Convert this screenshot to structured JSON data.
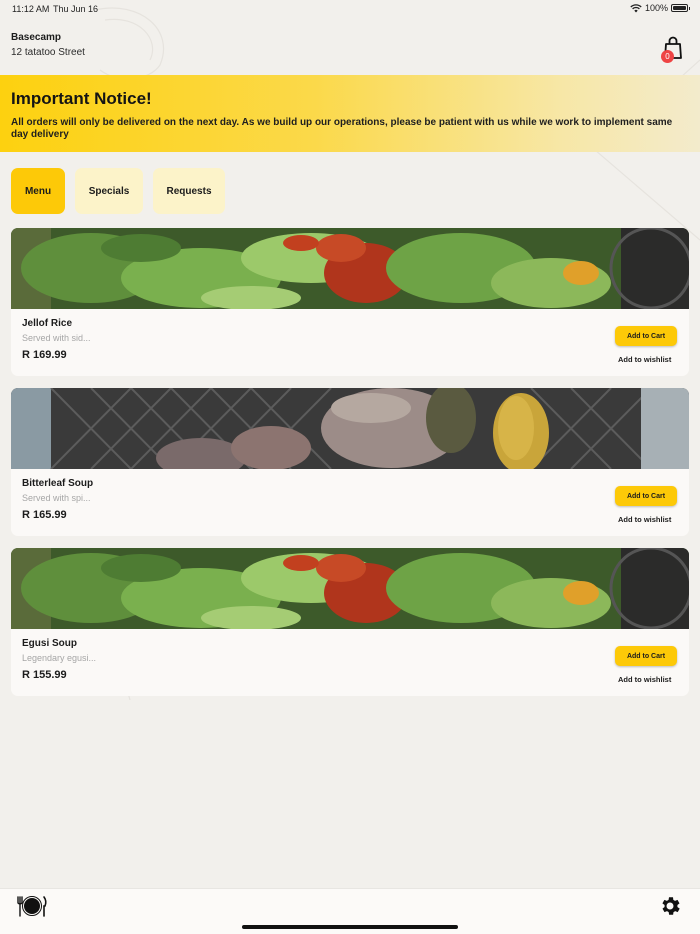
{
  "status_bar": {
    "time": "11:12 AM",
    "date": "Thu Jun 16",
    "battery": "100%"
  },
  "header": {
    "location_name": "Basecamp",
    "street": "12 tatatoo Street",
    "cart_count": "0",
    "cart_icon": "shopping-bag-icon"
  },
  "notice": {
    "title": "Important Notice!",
    "body": "All orders will only be delivered on the next day. As we build up our operations, please be patient with us while we work to implement same day delivery"
  },
  "tabs": [
    {
      "label": "Menu",
      "active": true
    },
    {
      "label": "Specials",
      "active": false
    },
    {
      "label": "Requests",
      "active": false
    }
  ],
  "items": [
    {
      "title": "Jellof Rice",
      "description": "Served with sid...",
      "price": "R 169.99",
      "add_label": "Add to Cart",
      "wishlist_label": "Add to wishlist"
    },
    {
      "title": "Bitterleaf Soup",
      "description": "Served with spi...",
      "price": "R 165.99",
      "add_label": "Add to Cart",
      "wishlist_label": "Add to wishlist"
    },
    {
      "title": "Egusi Soup",
      "description": "Legendary egusi...",
      "price": "R 155.99",
      "add_label": "Add to Cart",
      "wishlist_label": "Add to wishlist"
    }
  ],
  "bottom_nav": {
    "left_icon": "plate-cutlery-icon",
    "right_icon": "gear-icon"
  },
  "colors": {
    "accent": "#fdc908",
    "tab_inactive": "#fcf3c9",
    "badge": "#ee4444",
    "background": "#f2f0ec"
  }
}
